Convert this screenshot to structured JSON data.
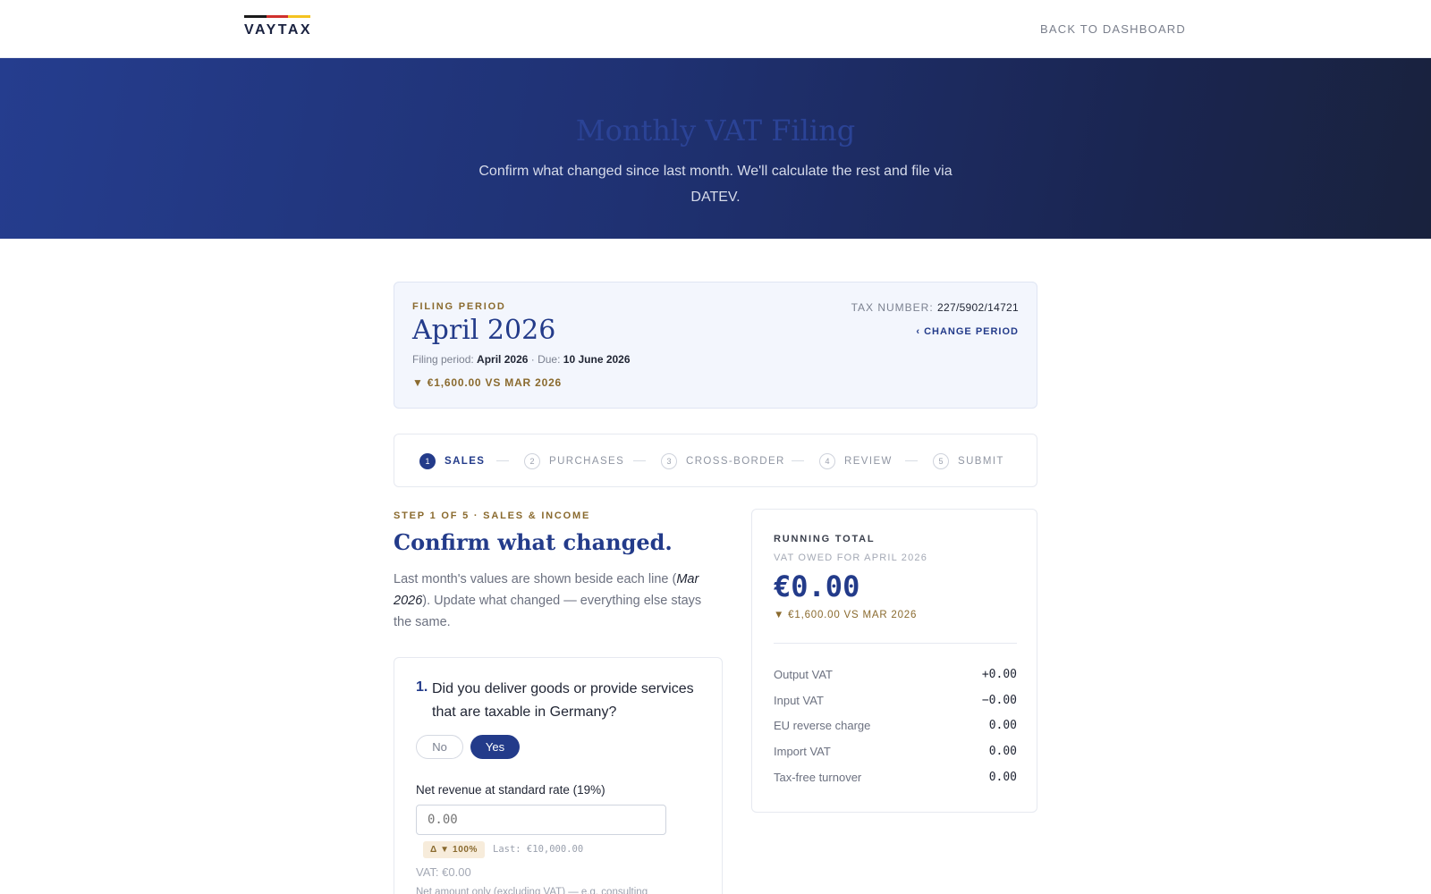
{
  "header": {
    "brand": "VAYTAX",
    "brand_colors": [
      "#1a1a1a",
      "#d0312d",
      "#f4c320"
    ],
    "back_link": "BACK TO DASHBOARD"
  },
  "hero": {
    "title": "Monthly VAT Filing",
    "subtitle": "Confirm what changed since last month. We'll calculate the rest and file via DATEV."
  },
  "period": {
    "eyebrow": "FILING PERIOD",
    "title": "April 2026",
    "filing_label": "Filing period:",
    "filing_value": "April 2026",
    "due_label": "· Due:",
    "due_value": "10 June 2026",
    "delta": "▼ €1,600.00 VS MAR 2026",
    "tax_label": "TAX NUMBER:",
    "tax_value": "227/5902/14721",
    "change": "‹ CHANGE PERIOD"
  },
  "steps": [
    {
      "num": "1",
      "label": "SALES",
      "active": true
    },
    {
      "num": "2",
      "label": "PURCHASES",
      "active": false
    },
    {
      "num": "3",
      "label": "CROSS-BORDER",
      "active": false
    },
    {
      "num": "4",
      "label": "REVIEW",
      "active": false
    },
    {
      "num": "5",
      "label": "SUBMIT",
      "active": false
    }
  ],
  "main": {
    "eyebrow": "STEP 1 OF 5 · SALES & INCOME",
    "title": "Confirm what changed.",
    "desc_pre": "Last month's values are shown beside each line (",
    "desc_em": "Mar 2026",
    "desc_post": "). Update what changed — everything else stays the same."
  },
  "question": {
    "num": "1.",
    "text": "Did you deliver goods or provide services that are taxable in Germany?",
    "no_label": "No",
    "yes_label": "Yes",
    "selected": "Yes",
    "field_label": "Net revenue at standard rate (19%)",
    "field_placeholder": "0.00",
    "delta_badge": "Δ ▼ 100%",
    "last_value": "Last: €10,000.00",
    "vat_line": "VAT: €0.00",
    "hint": "Net amount only (excluding VAT) — e.g. consulting"
  },
  "running_total": {
    "label": "RUNNING TOTAL",
    "sub": "VAT OWED FOR APRIL 2026",
    "amount": "€0.00",
    "delta": "▼ €1,600.00 VS MAR 2026",
    "rows": [
      {
        "label": "Output VAT",
        "value": "+0.00"
      },
      {
        "label": "Input VAT",
        "value": "−0.00"
      },
      {
        "label": "EU reverse charge",
        "value": "0.00"
      },
      {
        "label": "Import VAT",
        "value": "0.00"
      },
      {
        "label": "Tax-free turnover",
        "value": "0.00"
      }
    ]
  }
}
